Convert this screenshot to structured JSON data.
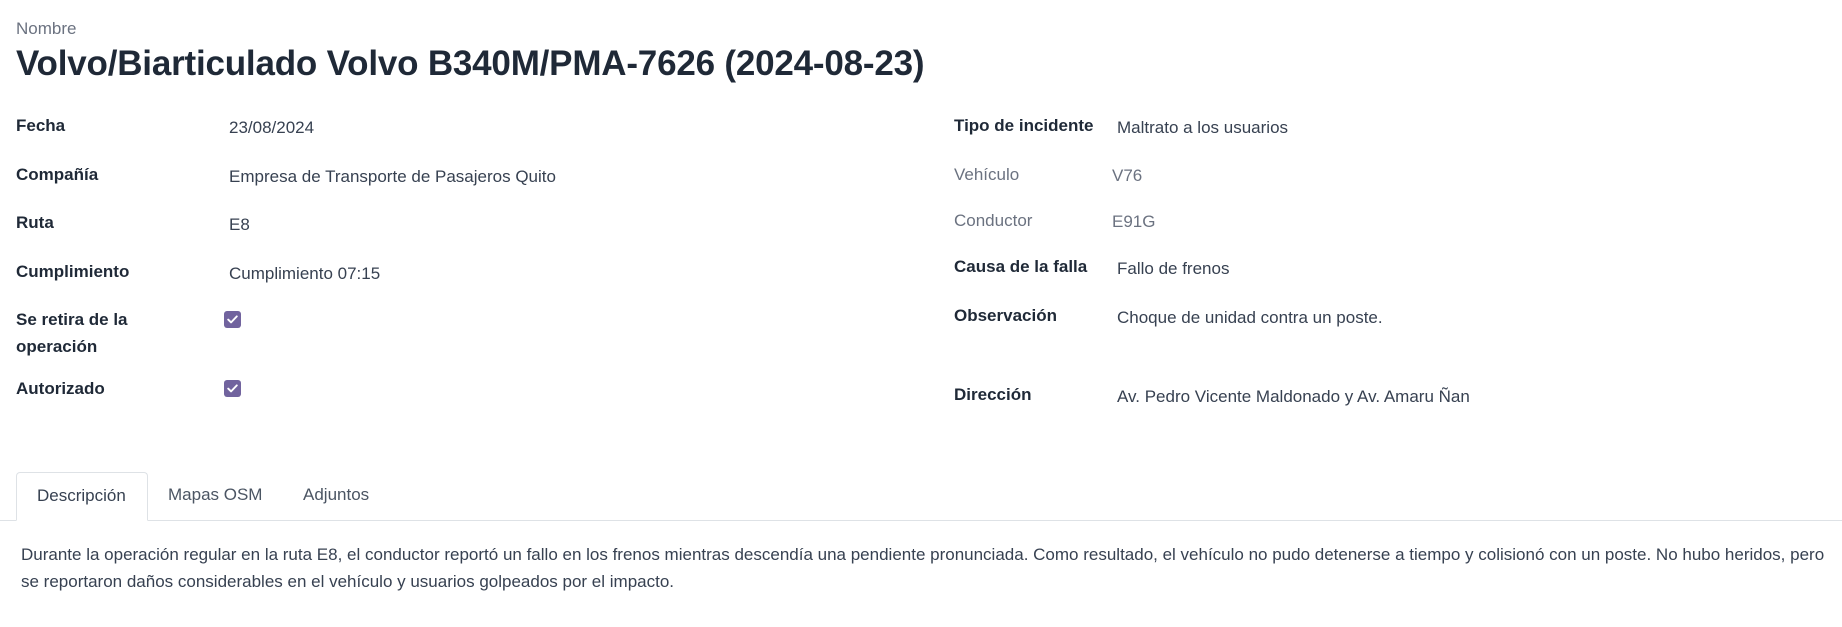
{
  "header": {
    "label": "Nombre",
    "title": "Volvo/Biarticulado Volvo B340M/PMA-7626 (2024-08-23)"
  },
  "left_fields": {
    "fecha": {
      "label": "Fecha",
      "value": "23/08/2024"
    },
    "compania": {
      "label": "Compañía",
      "value": "Empresa de Transporte de Pasajeros Quito"
    },
    "ruta": {
      "label": "Ruta",
      "value": "E8"
    },
    "cumplimiento": {
      "label": "Cumplimiento",
      "value": "Cumplimiento 07:15"
    },
    "se_retira": {
      "label": "Se retira de la operación",
      "checked": true
    },
    "autorizado": {
      "label": "Autorizado",
      "checked": true
    }
  },
  "right_fields": {
    "tipo_incidente": {
      "label": "Tipo de incidente",
      "value": "Maltrato a los usuarios"
    },
    "vehiculo": {
      "label": "Vehículo",
      "value": "V76"
    },
    "conductor": {
      "label": "Conductor",
      "value": "E91G"
    },
    "causa_falla": {
      "label": "Causa de la falla",
      "value": "Fallo de frenos"
    },
    "observacion": {
      "label": "Observación",
      "value": "Choque de unidad contra un poste."
    },
    "direccion": {
      "label": "Dirección",
      "value": "Av. Pedro Vicente Maldonado y Av. Amaru Ñan"
    }
  },
  "tabs": [
    {
      "label": "Descripción",
      "active": true
    },
    {
      "label": "Mapas OSM",
      "active": false
    },
    {
      "label": "Adjuntos",
      "active": false
    }
  ],
  "description": "Durante la operación regular en la ruta E8, el conductor reportó un fallo en los frenos mientras descendía una pendiente pronunciada. Como resultado, el vehículo no pudo detenerse a tiempo y colisionó con un poste. No hubo heridos, pero se reportaron daños considerables en el vehículo y usuarios golpeados por el impacto.",
  "colors": {
    "accent": "#71639e",
    "border": "#dee2e6",
    "text": "#374151"
  }
}
